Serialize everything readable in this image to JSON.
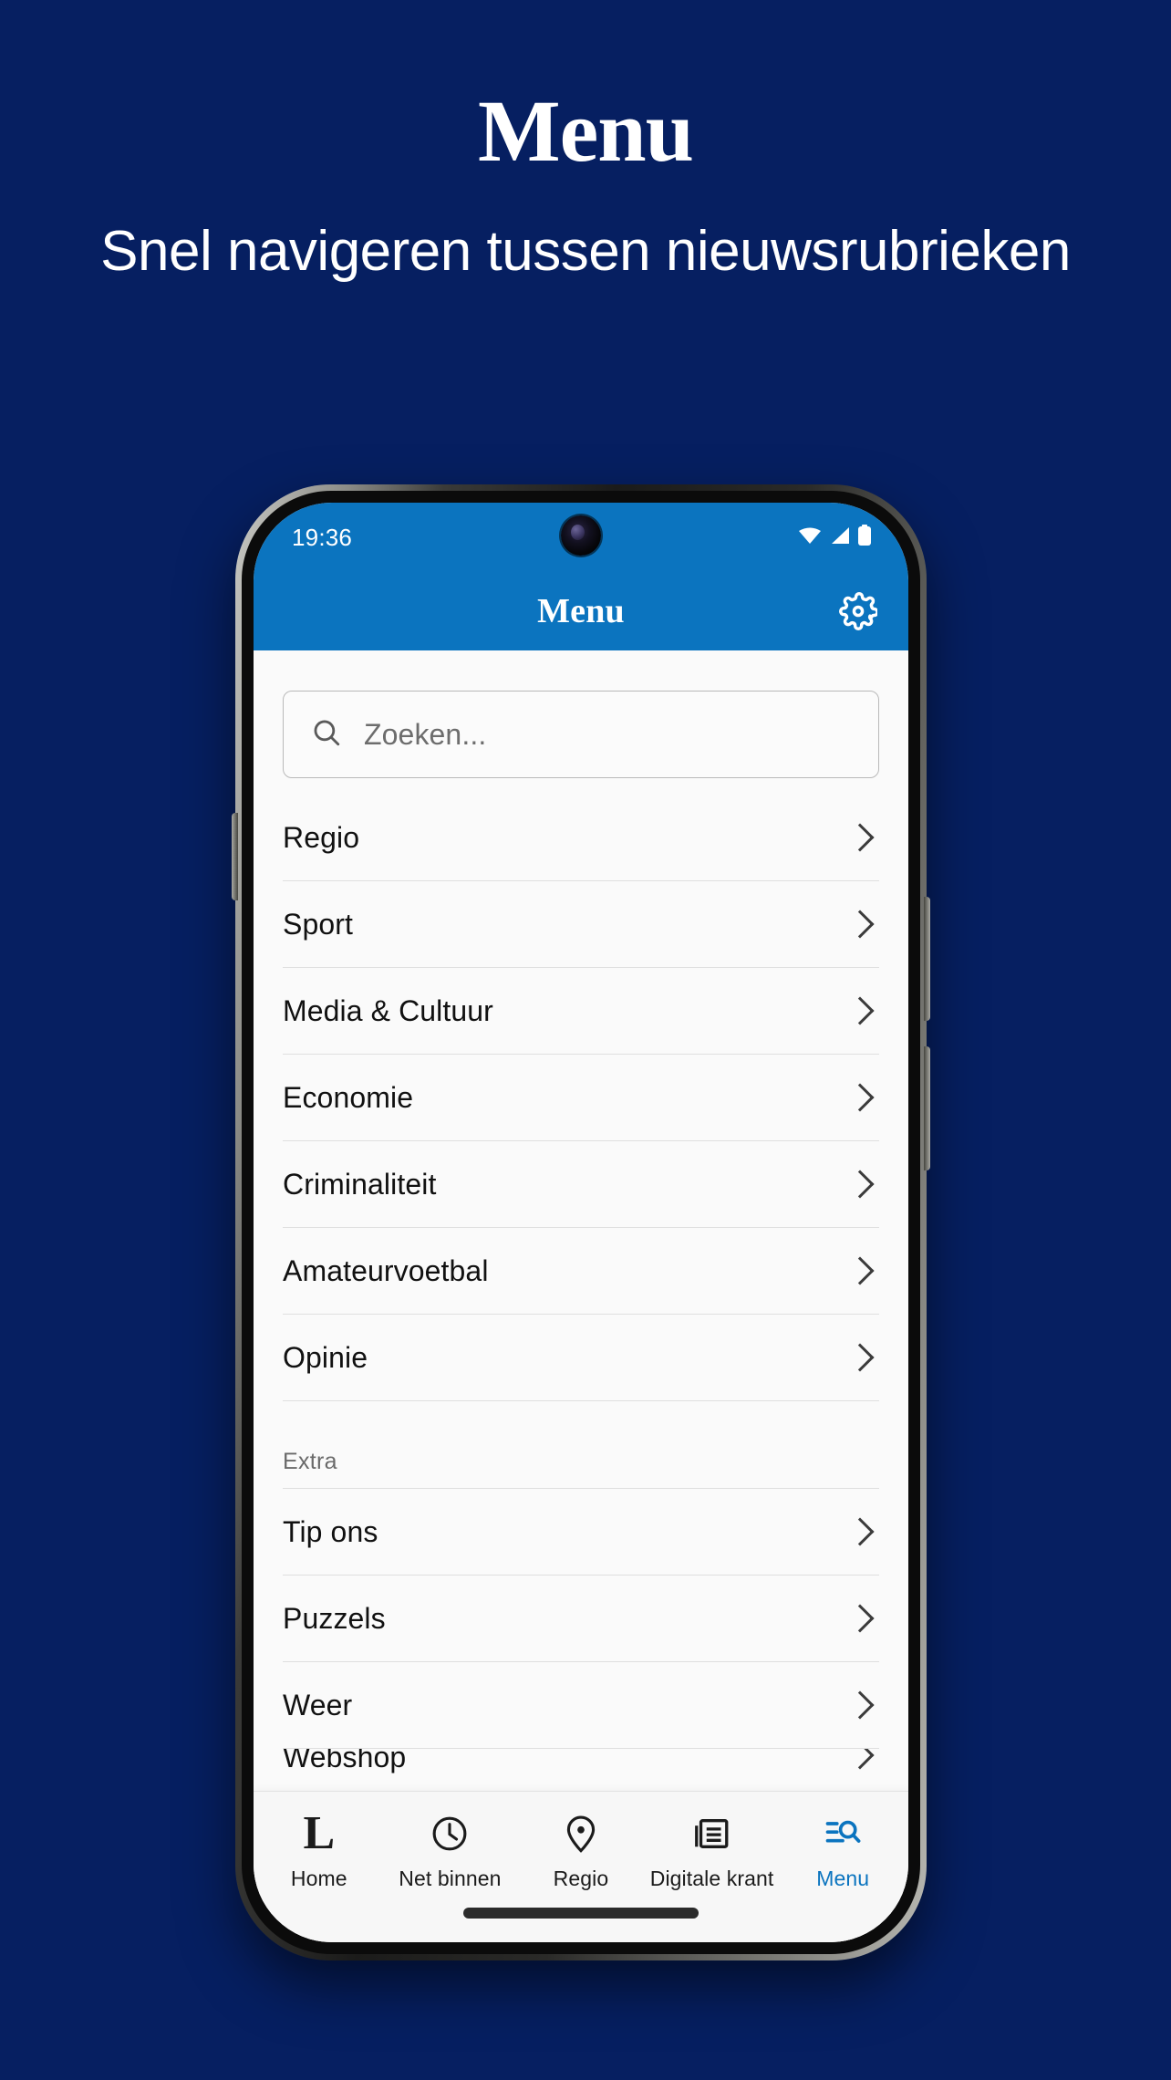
{
  "promo": {
    "title": "Menu",
    "subtitle": "Snel navigeren tussen nieuwsrubrieken"
  },
  "colors": {
    "background_navy": "#061f61",
    "brand_blue": "#0b74bf",
    "screen_background": "#fafafa",
    "divider": "#dfdfdf",
    "text_primary": "#111111",
    "text_muted": "#6a6a6a",
    "accent_active": "#0b74bf"
  },
  "status_bar": {
    "time": "19:36",
    "icons": [
      "wifi-icon",
      "cellular-signal-icon",
      "battery-icon"
    ]
  },
  "app_bar": {
    "title": "Menu",
    "action_icon": "gear-icon"
  },
  "search": {
    "icon": "search-icon",
    "placeholder": "Zoeken...",
    "value": ""
  },
  "menu": {
    "primary_items": [
      {
        "label": "Regio",
        "chevron": "chevron-right-icon"
      },
      {
        "label": "Sport",
        "chevron": "chevron-right-icon"
      },
      {
        "label": "Media & Cultuur",
        "chevron": "chevron-right-icon"
      },
      {
        "label": "Economie",
        "chevron": "chevron-right-icon"
      },
      {
        "label": "Criminaliteit",
        "chevron": "chevron-right-icon"
      },
      {
        "label": "Amateurvoetbal",
        "chevron": "chevron-right-icon"
      },
      {
        "label": "Opinie",
        "chevron": "chevron-right-icon"
      }
    ],
    "section_label": "Extra",
    "extra_items": [
      {
        "label": "Tip ons",
        "chevron": "chevron-right-icon"
      },
      {
        "label": "Puzzels",
        "chevron": "chevron-right-icon"
      },
      {
        "label": "Weer",
        "chevron": "chevron-right-icon"
      },
      {
        "label": "Webshop",
        "chevron": "chevron-right-icon"
      }
    ]
  },
  "bottom_nav": {
    "items": [
      {
        "label": "Home",
        "icon": "logo-l-icon",
        "active": false
      },
      {
        "label": "Net binnen",
        "icon": "clock-icon",
        "active": false
      },
      {
        "label": "Regio",
        "icon": "location-pin-icon",
        "active": false
      },
      {
        "label": "Digitale krant",
        "icon": "newspaper-icon",
        "active": false
      },
      {
        "label": "Menu",
        "icon": "menu-search-icon",
        "active": true
      }
    ]
  }
}
